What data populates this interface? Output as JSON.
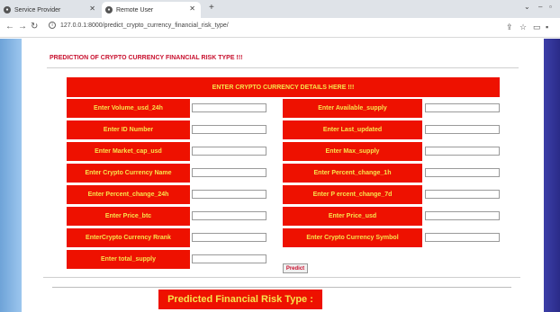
{
  "browser": {
    "tabs": [
      {
        "label": "Service Provider"
      },
      {
        "label": "Remote User"
      }
    ],
    "new_tab_label": "+",
    "url": "127.0.0.1:8000/predict_crypto_currency_financial_risk_type/"
  },
  "page": {
    "heading": "PREDICTION OF CRYPTO CURRENCY FINANCIAL RISK TYPE !!!",
    "form_header": "ENTER CRYPTO CURRENCY DETAILS HERE !!!",
    "left_fields": [
      {
        "label": "Enter Volume_usd_24h",
        "value": ""
      },
      {
        "label": "Enter ID Number",
        "value": ""
      },
      {
        "label": "Enter Market_cap_usd",
        "value": ""
      },
      {
        "label": "Enter Crypto Currency Name",
        "value": ""
      },
      {
        "label": "Enter Percent_change_24h",
        "value": ""
      },
      {
        "label": "Enter Price_btc",
        "value": ""
      },
      {
        "label": "EnterCrypto Currency Rrank",
        "value": ""
      },
      {
        "label": "Enter total_supply",
        "value": ""
      }
    ],
    "right_fields": [
      {
        "label": "Enter Available_supply",
        "value": ""
      },
      {
        "label": "Enter Last_updated",
        "value": ""
      },
      {
        "label": "Enter Max_supply",
        "value": ""
      },
      {
        "label": "Enter Percent_change_1h",
        "value": ""
      },
      {
        "label": "Enter P ercent_change_7d",
        "value": ""
      },
      {
        "label": "Enter Price_usd",
        "value": ""
      },
      {
        "label": "Enter Crypto Currency Symbol",
        "value": ""
      }
    ],
    "predict_button": "Predict",
    "result_label": "Predicted Financial Risk Type :"
  },
  "colors": {
    "label_bg": "#ee1100",
    "label_text": "#f7e34c",
    "heading_text": "#c8102e"
  }
}
